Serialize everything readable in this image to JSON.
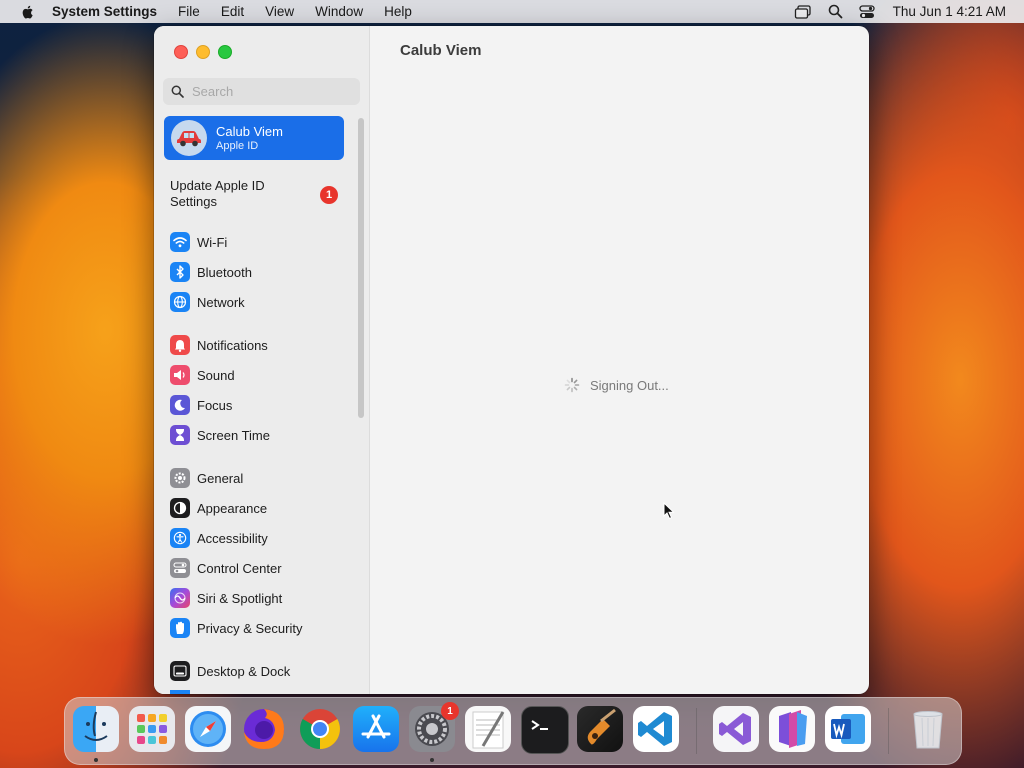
{
  "menubar": {
    "app_name": "System Settings",
    "menus": [
      "File",
      "Edit",
      "View",
      "Window",
      "Help"
    ],
    "clock": "Thu Jun 1  4:21 AM"
  },
  "window": {
    "title": "Calub Viem",
    "search_placeholder": "Search",
    "account": {
      "name": "Calub Viem",
      "subtitle": "Apple ID"
    },
    "update": {
      "label": "Update Apple ID Settings",
      "badge": "1"
    },
    "sidebar_items": [
      {
        "label": "Wi-Fi",
        "icon": "wifi-icon",
        "color": "#1a84f5"
      },
      {
        "label": "Bluetooth",
        "icon": "bluetooth-icon",
        "color": "#1a84f5"
      },
      {
        "label": "Network",
        "icon": "globe-icon",
        "color": "#1a84f5"
      },
      {
        "label": "Notifications",
        "icon": "bell-icon",
        "color": "#ef4a4a"
      },
      {
        "label": "Sound",
        "icon": "speaker-icon",
        "color": "#ee4d6d"
      },
      {
        "label": "Focus",
        "icon": "moon-icon",
        "color": "#5b57d6"
      },
      {
        "label": "Screen Time",
        "icon": "hourglass-icon",
        "color": "#6e4fd3"
      },
      {
        "label": "General",
        "icon": "gear-icon",
        "color": "#8f8f94"
      },
      {
        "label": "Appearance",
        "icon": "appearance-icon",
        "color": "#1d1d1f"
      },
      {
        "label": "Accessibility",
        "icon": "accessibility-icon",
        "color": "#1a84f5"
      },
      {
        "label": "Control Center",
        "icon": "control-center-icon",
        "color": "#8f8f94"
      },
      {
        "label": "Siri & Spotlight",
        "icon": "siri-icon",
        "color": "#a54bd9"
      },
      {
        "label": "Privacy & Security",
        "icon": "hand-icon",
        "color": "#1a84f5"
      },
      {
        "label": "Desktop & Dock",
        "icon": "dock-icon",
        "color": "#1d1d1f"
      }
    ],
    "status_text": "Signing Out..."
  },
  "dock": {
    "settings_badge": "1",
    "apps": [
      "Finder",
      "Launchpad",
      "Safari",
      "Firefox",
      "Chrome",
      "App Store",
      "System Settings",
      "TextEdit",
      "Terminal",
      "GarageBand",
      "Visual Studio Code",
      "Visual Studio",
      "Power Apps",
      "Microsoft Word",
      "Trash"
    ]
  }
}
